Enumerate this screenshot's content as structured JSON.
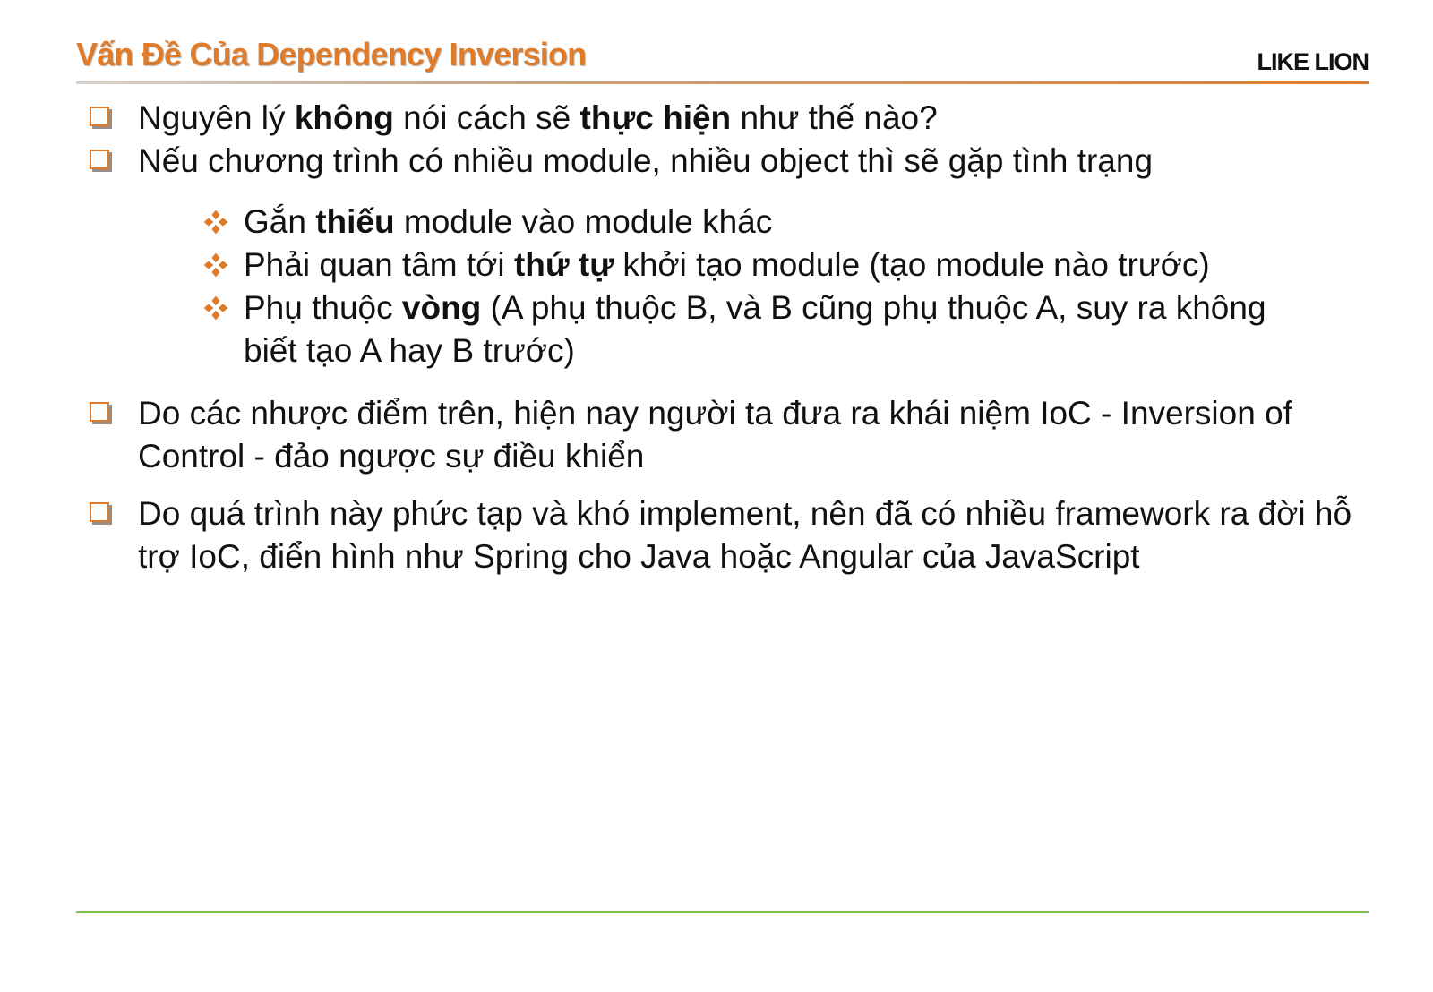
{
  "slide": {
    "title": "Vấn Đề Của Dependency Inversion",
    "brand": "LIKE LION",
    "colors": {
      "accent": "#E07B2A",
      "footer_line": "#7DC24B",
      "text": "#111111"
    }
  },
  "bullets": [
    {
      "parts": [
        "Nguyên lý ",
        "không",
        " nói cách sẽ ",
        "thực hiện",
        " như thế nào?"
      ]
    },
    {
      "parts": [
        "Nếu chương trình có nhiều module, nhiều object thì sẽ gặp tình trạng"
      ]
    }
  ],
  "sub_bullets": [
    {
      "parts": [
        "Gắn ",
        "thiếu",
        " module vào module khác"
      ]
    },
    {
      "parts": [
        "Phải quan tâm tới ",
        "thứ tự",
        " khởi tạo module (tạo module nào trước)"
      ]
    },
    {
      "parts": [
        "Phụ thuộc ",
        "vòng",
        " (A phụ thuộc B, và B cũng phụ thuộc A, suy ra không biết tạo A hay B trước)"
      ]
    }
  ],
  "bullets_after": [
    {
      "text": "Do các nhược điểm trên, hiện nay người ta đưa ra khái niệm IoC - Inversion of Control - đảo ngược sự điều khiển"
    },
    {
      "text": "Do quá trình này phức tạp và khó implement, nên đã có nhiều framework ra đời hỗ trợ IoC, điển hình như Spring cho Java hoặc Angular của JavaScript"
    }
  ],
  "icons": {
    "bullet": "checkbox-square-icon",
    "sub_bullet": "four-diamond-icon"
  }
}
